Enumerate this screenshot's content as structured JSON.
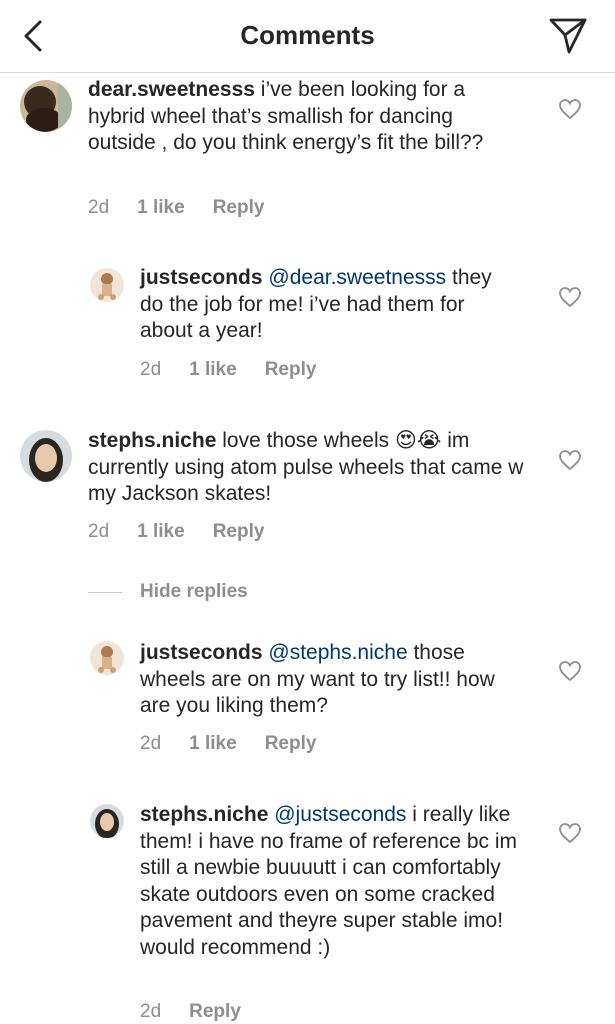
{
  "header": {
    "title": "Comments"
  },
  "comments": [
    {
      "user": "dear.sweetnesss",
      "text": "i’ve been looking for a hybrid wheel that’s smallish for dancing outside , do you think energy’s fit the bill??",
      "time": "2d",
      "likes": "1 like",
      "reply": "Reply"
    },
    {
      "user": "justseconds",
      "mention": "@dear.sweetnesss",
      "text": "they do the job for me! i’ve had them for about a year!",
      "time": "2d",
      "likes": "1 like",
      "reply": "Reply"
    },
    {
      "user": "stephs.niche",
      "text": "love those wheels 😍😭 im currently using atom pulse wheels that came w my Jackson skates!",
      "time": "2d",
      "likes": "1 like",
      "reply": "Reply"
    },
    {
      "user": "justseconds",
      "mention": "@stephs.niche",
      "text": "those wheels are on my want to try list!! how are you liking them?",
      "time": "2d",
      "likes": "1 like",
      "reply": "Reply"
    },
    {
      "user": "stephs.niche",
      "mention": "@justseconds",
      "text": "i really like them! i have no frame of reference bc im still a newbie buuuutt i can comfortably skate outdoors even on some cracked pavement and theyre super stable imo! would recommend :)",
      "time": "2d",
      "reply": "Reply"
    }
  ],
  "hide_replies": "Hide replies",
  "colors": {
    "mention": "#00376b",
    "meta": "#8e8e8e",
    "text": "#262626"
  }
}
